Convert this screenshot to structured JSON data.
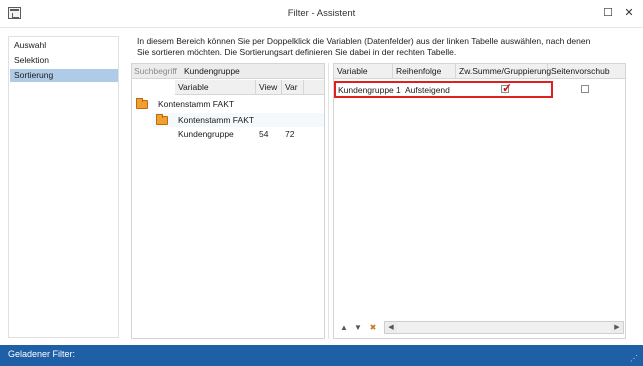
{
  "window": {
    "title": "Filter - Assistent",
    "maximize_icon": "☐",
    "close_icon": "✕"
  },
  "nav": {
    "items": [
      {
        "label": "Auswahl"
      },
      {
        "label": "Selektion"
      },
      {
        "label": "Sortierung",
        "selected": true
      }
    ]
  },
  "description": {
    "line1": "In diesem Bereich können Sie per Doppelklick die Variablen (Datenfelder) aus der linken Tabelle auswählen, nach denen",
    "line2": "Sie sortieren möchten. Die Sortierungsart definieren Sie dabei in der rechten Tabelle."
  },
  "left_table": {
    "search_label": "Suchbegriff",
    "search_value": "Kundengruppe",
    "headers": {
      "variable": "Variable",
      "view": "View",
      "var": "Var"
    },
    "group": "Kontenstamm FAKT",
    "subgroup": "Kontenstamm FAKT",
    "row": {
      "variable": "Kundengruppe",
      "view": "54",
      "var": "72"
    }
  },
  "right_table": {
    "headers": {
      "variable": "Variable",
      "reihenfolge": "Reihenfolge",
      "zwsumme": "Zw.Summe/Gruppierung",
      "seitenvorschub": "Seitenvorschub"
    },
    "row": {
      "variable": "Kundengruppe",
      "reihenfolge": "1  Aufsteigend",
      "zwsumme_checked": true,
      "seitenvorschub_checked": false
    },
    "check_glyph": "✓",
    "toolbar": {
      "up_icon": "▲",
      "down_icon": "▼",
      "delete_icon": "✖",
      "scroll_left": "◀",
      "scroll_right": "▶"
    }
  },
  "status": {
    "text": "Geladener Filter:"
  },
  "colors": {
    "status_bar": "#1f5fa6",
    "selection": "#b0cbe7",
    "highlight": "#e02020"
  }
}
